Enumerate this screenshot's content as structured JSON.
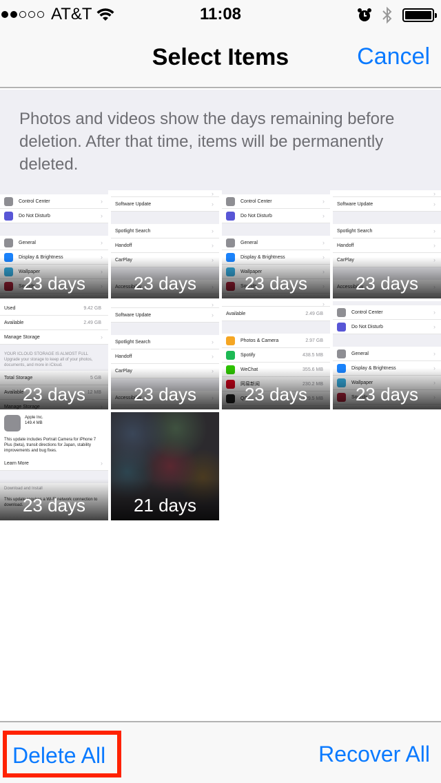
{
  "status_bar": {
    "signal_filled": 2,
    "signal_total": 5,
    "carrier": "AT&T",
    "time": "11:08",
    "icons": [
      "wifi-icon",
      "alarm-icon",
      "bluetooth-icon",
      "battery-icon"
    ],
    "battery_level": 1.0
  },
  "nav": {
    "title": "Select Items",
    "cancel_label": "Cancel"
  },
  "info_text": "Photos and videos show the days remaining before deletion. After that time, items will be permanently deleted.",
  "colors": {
    "accent": "#0a7aff",
    "highlight_box": "#ff2200",
    "info_bg": "#efeff4",
    "info_text": "#6d6d72"
  },
  "items": [
    {
      "days": "23 days",
      "kind": "settings-general"
    },
    {
      "days": "23 days",
      "kind": "settings-general-sub"
    },
    {
      "days": "23 days",
      "kind": "settings-general"
    },
    {
      "days": "23 days",
      "kind": "settings-general-sub"
    },
    {
      "days": "23 days",
      "kind": "storage"
    },
    {
      "days": "23 days",
      "kind": "settings-general-sub"
    },
    {
      "days": "23 days",
      "kind": "app-storage"
    },
    {
      "days": "23 days",
      "kind": "settings-general"
    },
    {
      "days": "23 days",
      "kind": "software-update"
    },
    {
      "days": "21 days",
      "kind": "blurred-photo"
    }
  ],
  "thumb_text": {
    "settings_main": [
      {
        "label": "Control Center",
        "color": "#8e8e93"
      },
      {
        "label": "Do Not Disturb",
        "color": "#5856d6"
      },
      {
        "gap": true
      },
      {
        "label": "General",
        "color": "#8e8e93"
      },
      {
        "label": "Display & Brightness",
        "color": "#1a82fb"
      },
      {
        "label": "Wallpaper",
        "color": "#35aadc"
      },
      {
        "label": "Sounds",
        "color": "#b0223a"
      }
    ],
    "settings_sub": [
      "Software Update",
      "Spotlight Search",
      "Handoff",
      "CarPlay",
      "Accessibility"
    ],
    "storage": {
      "rows": [
        {
          "label": "Used",
          "value": "9.42 GB"
        },
        {
          "label": "Available",
          "value": "2.49 GB"
        },
        {
          "label": "Manage Storage",
          "value": ""
        }
      ],
      "notice_title": "YOUR ICLOUD STORAGE IS ALMOST FULL",
      "notice_body": "Upgrade your storage to keep all of your photos, documents, and more in iCloud.",
      "rows2": [
        {
          "label": "Total Storage",
          "value": "5 GB"
        },
        {
          "label": "Available",
          "value": "12 MB"
        },
        {
          "label": "Manage Storage",
          "value": ""
        }
      ]
    },
    "apps": {
      "available_label": "Available",
      "available_value": "2.49 GB",
      "rows": [
        {
          "label": "Photos & Camera",
          "value": "2.97 GB",
          "color": "#f5a623"
        },
        {
          "label": "Spotify",
          "value": "438.5 MB",
          "color": "#1db954"
        },
        {
          "label": "WeChat",
          "value": "355.6 MB",
          "color": "#2dc100"
        },
        {
          "label": "网易新闻",
          "value": "230.2 MB",
          "color": "#d0021b"
        },
        {
          "label": "QQ",
          "value": "129.5 MB",
          "color": "#222222"
        }
      ]
    },
    "update": {
      "vendor": "Apple Inc.",
      "size": "149.4 MB",
      "description": "This update includes Portrait Camera for iPhone 7 Plus (beta), transit directions for Japan, stability improvements and bug fixes.",
      "learn_more": "Learn More",
      "download": "Download and Install",
      "wifi_note": "This update requires a Wi-Fi network connection to download."
    }
  },
  "toolbar": {
    "delete_all_label": "Delete All",
    "recover_all_label": "Recover All"
  }
}
